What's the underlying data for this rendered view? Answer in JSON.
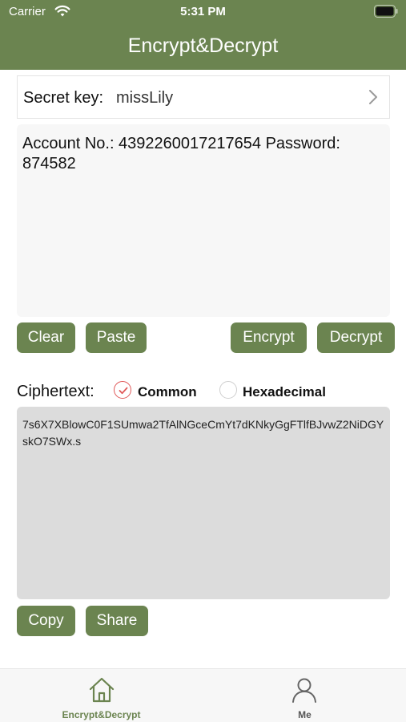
{
  "status_bar": {
    "carrier": "Carrier",
    "time": "5:31 PM"
  },
  "header": {
    "title": "Encrypt&Decrypt"
  },
  "secret_key": {
    "label": "Secret key:",
    "value": "missLily"
  },
  "input": {
    "text": "Account No.: 4392260017217654 Password: 874582"
  },
  "buttons": {
    "clear": "Clear",
    "paste": "Paste",
    "encrypt": "Encrypt",
    "decrypt": "Decrypt",
    "copy": "Copy",
    "share": "Share"
  },
  "ciphertext": {
    "label": "Ciphertext:",
    "options": [
      {
        "label": "Common",
        "selected": true
      },
      {
        "label": "Hexadecimal",
        "selected": false
      }
    ],
    "value": "7s6X7XBlowC0F1SUmwa2TfAlNGceCmYt7dKNkyGgFTlfBJvwZ2NiDGYskO7SWx.s"
  },
  "tabbar": {
    "tabs": [
      {
        "label": "Encrypt&Decrypt",
        "icon": "home-icon",
        "active": true
      },
      {
        "label": "Me",
        "icon": "person-icon",
        "active": false
      }
    ]
  },
  "colors": {
    "accent": "#6b8450",
    "radio_checked": "#e05858",
    "input_bg": "#f7f7f7",
    "cipher_bg": "#dcdcdc"
  }
}
